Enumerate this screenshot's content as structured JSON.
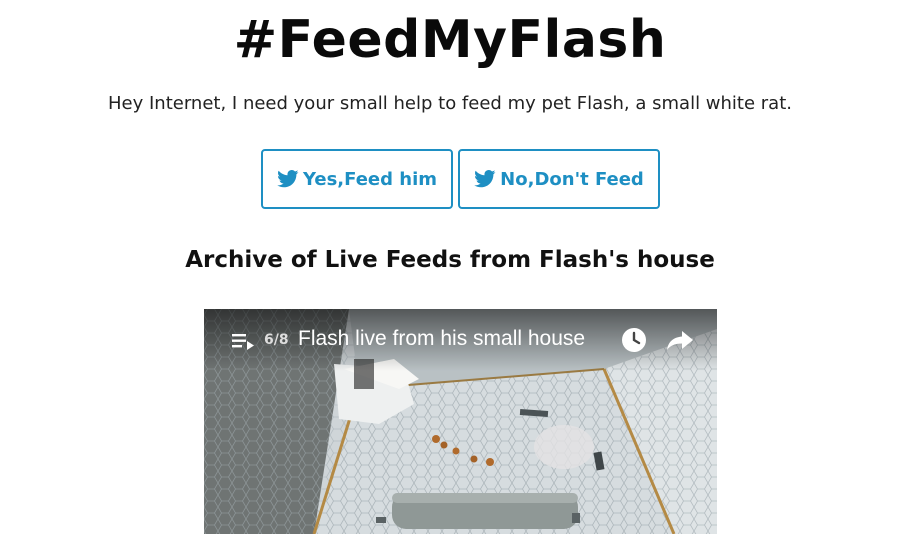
{
  "header": {
    "title": "#FeedMyFlash",
    "subtitle": "Hey Internet, I need your small help to feed my pet Flash, a small white rat."
  },
  "actions": {
    "yes_label": "Yes,Feed him",
    "no_label": "No,Don't Feed",
    "icon": "twitter-bird-icon",
    "accent_color": "#1e8fc3"
  },
  "archive": {
    "heading": "Archive of Live Feeds from Flash's house"
  },
  "video": {
    "playlist_position": "6/8",
    "title": "Flash live from his small house",
    "icons": [
      "playlist-icon",
      "watch-later-clock-icon",
      "share-arrow-icon"
    ]
  }
}
